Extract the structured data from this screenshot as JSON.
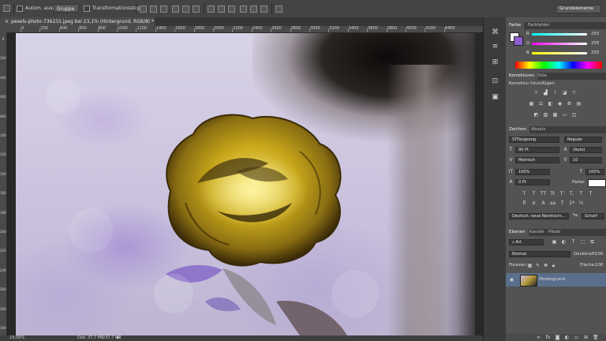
{
  "options_bar": {
    "auto_select_label": "Autom. ausw.:",
    "auto_select_value": "Gruppe",
    "transform_label": "Transformationsstrg.",
    "workspace": "Grundelemente"
  },
  "document": {
    "tab_title": "pexels-photo-736231.jpeg bei 23,1% (Hintergrund, RGB/8) *",
    "close_glyph": "×"
  },
  "rulers": {
    "h_ticks": [
      "0",
      "200",
      "400",
      "600",
      "800",
      "1000",
      "1200",
      "1400",
      "1600",
      "1800",
      "2000",
      "2200",
      "2400",
      "2600",
      "2800",
      "3000",
      "3200",
      "3400",
      "3600",
      "3800",
      "4000",
      "4200",
      "4400"
    ],
    "v_ticks": [
      "0",
      "200",
      "400",
      "600",
      "800",
      "1000",
      "1200",
      "1400",
      "1600",
      "1800",
      "2000",
      "2200",
      "2400",
      "2600",
      "2800",
      "3000"
    ]
  },
  "status_bar": {
    "zoom": "23,09%",
    "doc_info": "Dok: 37,7 MB/37,7 MB",
    "arrow": "▶"
  },
  "color_panel": {
    "tabs": [
      "Farbe",
      "Farbfelder"
    ],
    "channels": [
      {
        "label": "R",
        "value": "255"
      },
      {
        "label": "G",
        "value": "255"
      },
      {
        "label": "B",
        "value": "255"
      }
    ]
  },
  "adjustments_panel": {
    "tabs": [
      "Korrekturen",
      "Stile"
    ],
    "heading": "Korrektur hinzufügen"
  },
  "character_panel": {
    "tabs": [
      "Zeichen",
      "Absatz"
    ],
    "font_family": "STFangsong",
    "font_style": "Regular",
    "font_size": "90 Pt",
    "leading": "(Auto)",
    "kerning": "Metrisch",
    "tracking": "10",
    "vscale": "100%",
    "hscale": "100%",
    "baseline": "0 Pt",
    "color_label": "Farbe:",
    "language": "Deutsch: neue Rechtschr...",
    "antialias": "Scharf",
    "aa_label": "ªa"
  },
  "layers_panel": {
    "tabs": [
      "Ebenen",
      "Kanäle",
      "Pfade"
    ],
    "filter": "Art",
    "blend_mode": "Normal",
    "opacity_label": "Deckkraft:",
    "opacity_value": "100",
    "lock_label": "Fixieren:",
    "fill_label": "Fläche:",
    "fill_value": "100",
    "layer_name": "Hintergrund"
  },
  "colors": {
    "ui_bg": "#535353",
    "selected_layer": "#5b6f8c",
    "rose_yellow": "#c9a81a"
  }
}
